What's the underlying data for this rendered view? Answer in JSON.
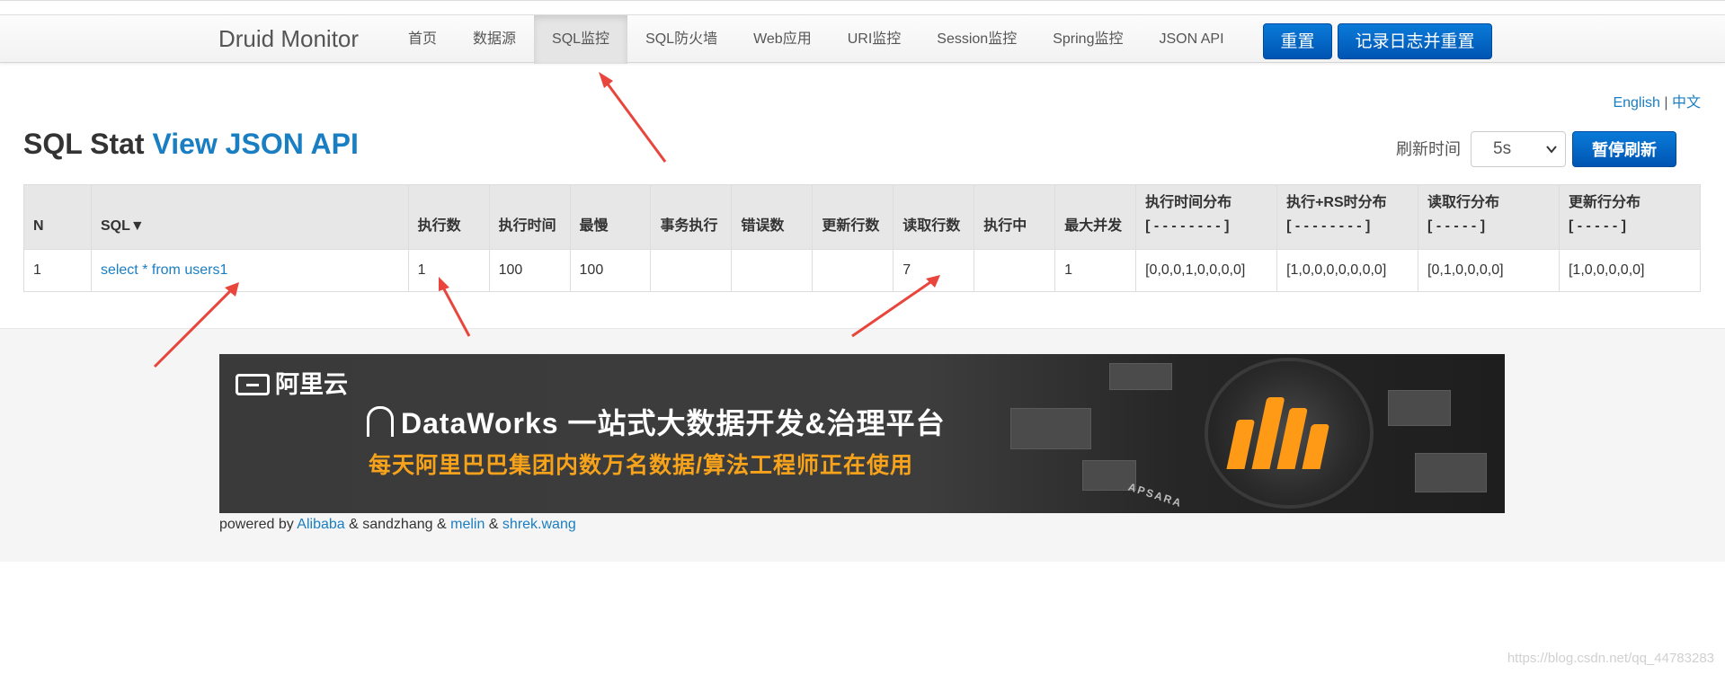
{
  "header": {
    "brand": "Druid Monitor",
    "nav": [
      {
        "label": "首页",
        "active": false
      },
      {
        "label": "数据源",
        "active": false
      },
      {
        "label": "SQL监控",
        "active": true
      },
      {
        "label": "SQL防火墙",
        "active": false
      },
      {
        "label": "Web应用",
        "active": false
      },
      {
        "label": "URI监控",
        "active": false
      },
      {
        "label": "Session监控",
        "active": false
      },
      {
        "label": "Spring监控",
        "active": false
      },
      {
        "label": "JSON API",
        "active": false
      }
    ],
    "reset_label": "重置",
    "log_reset_label": "记录日志并重置"
  },
  "lang": {
    "english": "English",
    "separator": "|",
    "chinese": "中文"
  },
  "page": {
    "title": "SQL Stat",
    "json_link": "View JSON API"
  },
  "refresh": {
    "label": "刷新时间",
    "selected": "5s",
    "pause_label": "暂停刷新"
  },
  "table": {
    "headers": {
      "n": "N",
      "sql": "SQL▼",
      "exec_count": "执行数",
      "exec_time": "执行时间",
      "slowest": "最慢",
      "txn_exec": "事务执行",
      "error_count": "错误数",
      "update_rows": "更新行数",
      "fetch_rows": "读取行数",
      "running": "执行中",
      "max_concurrent": "最大并发",
      "exec_time_dist": "执行时间分布",
      "exec_time_dist_sub": "[ - - - - - - - - ]",
      "exec_rs_dist": "执行+RS时分布",
      "exec_rs_dist_sub": "[ - - - - - - - - ]",
      "fetch_dist": "读取行分布",
      "fetch_dist_sub": "[ - - - - - ]",
      "update_dist": "更新行分布",
      "update_dist_sub": "[ - - - - - ]"
    },
    "rows": [
      {
        "n": "1",
        "sql": "select * from users1",
        "exec_count": "1",
        "exec_time": "100",
        "slowest": "100",
        "txn_exec": "",
        "error_count": "",
        "update_rows": "",
        "fetch_rows": "7",
        "running": "",
        "max_concurrent": "1",
        "exec_time_dist": "[0,0,0,1,0,0,0,0]",
        "exec_rs_dist": "[1,0,0,0,0,0,0,0]",
        "fetch_dist": "[0,1,0,0,0,0]",
        "update_dist": "[1,0,0,0,0,0]"
      }
    ]
  },
  "banner": {
    "logo_text": "阿里云",
    "product": "DataWorks",
    "headline": "一站式大数据开发&治理平台",
    "subline": "每天阿里巴巴集团内数万名数据/算法工程师正在使用",
    "apsara": "APSARA",
    "accent_color": "#ff9a17"
  },
  "footer": {
    "powered_by": "powered by",
    "alibaba": "Alibaba",
    "amp1": "&",
    "sandzhang": "sandzhang",
    "amp2": "&",
    "melin": "melin",
    "amp3": "&",
    "shrek": "shrek.wang"
  },
  "watermark": "https://blog.csdn.net/qq_44783283",
  "colors": {
    "link": "#1a7ec2",
    "button": "#0a6cd1",
    "arrow": "#e8453c"
  }
}
